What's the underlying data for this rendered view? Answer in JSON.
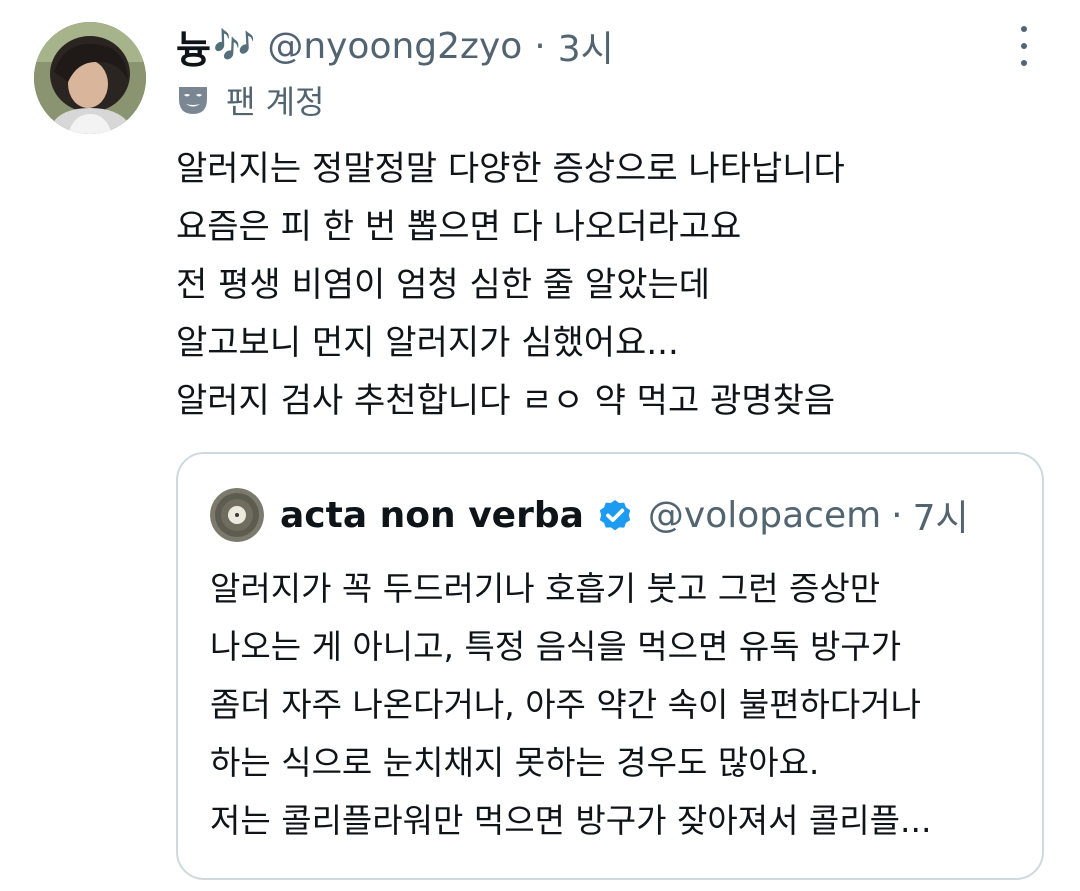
{
  "tweet": {
    "author": {
      "display_name": "늉",
      "name_emoji": "🎶",
      "handle": "@nyoong2zyo",
      "time": "3시",
      "fan_label": "팬 계정"
    },
    "separator": "·",
    "body_lines": [
      "알러지는 정말정말 다양한 증상으로 나타납니다",
      "요즘은 피 한 번 뽑으면 다 나오더라고요",
      "전 평생 비염이 엄청 심한 줄 알았는데",
      "알고보니 먼지 알러지가 심했어요...",
      "알러지 검사 추천합니다 ㄹㅇ 약 먹고 광명찾음"
    ]
  },
  "quoted": {
    "display_name": "acta non verba",
    "handle": "@volopacem",
    "time": "7시",
    "separator": "·",
    "verified": true,
    "verified_color": "#1d9bf0",
    "body_lines": [
      "알러지가 꼭 두드러기나 호흡기 붓고 그런 증상만",
      "나오는 게 아니고, 특정 음식을 먹으면 유독 방구가",
      "좀더 자주 나온다거나, 아주 약간 속이 불편하다거나",
      "하는 식으로 눈치채지 못하는 경우도 많아요.",
      "저는 콜리플라워만 먹으면 방구가 잦아져서 콜리플..."
    ]
  },
  "icons": {
    "more": "more-vertical-icon",
    "fan": "mask-icon",
    "verified": "verified-badge-icon"
  },
  "colors": {
    "text": "#0f1419",
    "secondary": "#536471",
    "border": "#cfd9de",
    "accent": "#1d9bf0"
  }
}
